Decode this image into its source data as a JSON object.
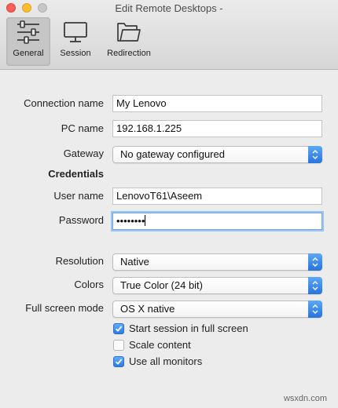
{
  "window": {
    "title": "Edit Remote Desktops -"
  },
  "toolbar": {
    "items": [
      {
        "label": "General",
        "icon": "sliders-icon",
        "active": true
      },
      {
        "label": "Session",
        "icon": "monitor-icon",
        "active": false
      },
      {
        "label": "Redirection",
        "icon": "folder-icon",
        "active": false
      }
    ]
  },
  "form": {
    "connection_name": {
      "label": "Connection name",
      "value": "My Lenovo"
    },
    "pc_name": {
      "label": "PC name",
      "value": "192.168.1.225"
    },
    "gateway": {
      "label": "Gateway",
      "value": "No gateway configured"
    },
    "credentials_heading": "Credentials",
    "user_name": {
      "label": "User name",
      "value": "LenovoT61\\Aseem"
    },
    "password": {
      "label": "Password",
      "value": "••••••••"
    },
    "resolution": {
      "label": "Resolution",
      "value": "Native"
    },
    "colors": {
      "label": "Colors",
      "value": "True Color (24 bit)"
    },
    "full_screen_mode": {
      "label": "Full screen mode",
      "value": "OS X native"
    }
  },
  "options": [
    {
      "label": "Start session in full screen",
      "checked": true
    },
    {
      "label": "Scale content",
      "checked": false
    },
    {
      "label": "Use all monitors",
      "checked": true
    }
  ],
  "watermark": "wsxdn.com",
  "colors": {
    "accent": "#2d7ae3",
    "focus_ring": "#9cc3f2",
    "window_bg": "#ececec"
  }
}
